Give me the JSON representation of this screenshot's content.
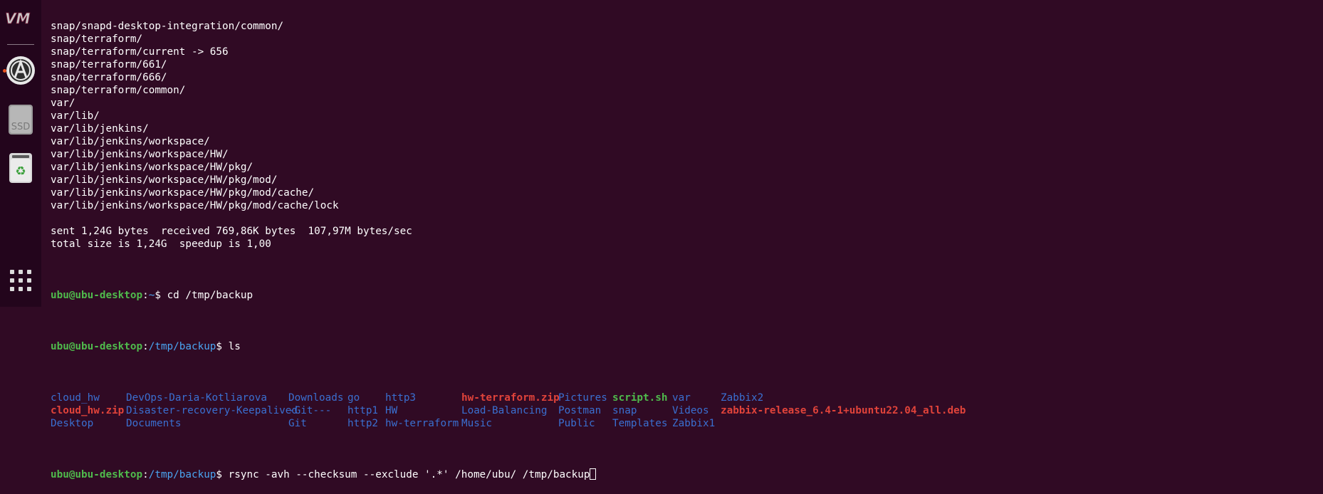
{
  "dock": {
    "items": [
      {
        "name": "virt-manager-icon"
      },
      {
        "name": "apt-package-icon"
      },
      {
        "name": "ssd-drive-icon",
        "label": "SSD"
      },
      {
        "name": "trash-icon"
      },
      {
        "name": "show-apps-grid-icon"
      }
    ]
  },
  "terminal": {
    "output_lines": [
      "snap/snapd-desktop-integration/common/",
      "snap/terraform/",
      "snap/terraform/current -> 656",
      "snap/terraform/661/",
      "snap/terraform/666/",
      "snap/terraform/common/",
      "var/",
      "var/lib/",
      "var/lib/jenkins/",
      "var/lib/jenkins/workspace/",
      "var/lib/jenkins/workspace/HW/",
      "var/lib/jenkins/workspace/HW/pkg/",
      "var/lib/jenkins/workspace/HW/pkg/mod/",
      "var/lib/jenkins/workspace/HW/pkg/mod/cache/",
      "var/lib/jenkins/workspace/HW/pkg/mod/cache/lock",
      "",
      "sent 1,24G bytes  received 769,86K bytes  107,97M bytes/sec",
      "total size is 1,24G  speedup is 1,00"
    ],
    "prompts": [
      {
        "user": "ubu@ubu-desktop",
        "sep": ":",
        "path": "~",
        "symbol": "$ ",
        "command": "cd /tmp/backup"
      },
      {
        "user": "ubu@ubu-desktop",
        "sep": ":",
        "path": "/tmp/backup",
        "symbol": "$ ",
        "command": "ls"
      },
      {
        "user": "ubu@ubu-desktop",
        "sep": ":",
        "path": "/tmp/backup",
        "symbol": "$ ",
        "command": "rsync -avh --checksum --exclude '.*' /home/ubu/ /tmp/backup"
      }
    ],
    "ls_columns": [
      [
        {
          "t": "cloud_hw",
          "k": "dir"
        },
        {
          "t": "cloud_hw.zip",
          "k": "red"
        },
        {
          "t": "Desktop",
          "k": "dir"
        }
      ],
      [
        {
          "t": "DevOps-Daria-Kotliarova",
          "k": "dir"
        },
        {
          "t": "Disaster-recovery-Keepalived",
          "k": "dir"
        },
        {
          "t": "Documents",
          "k": "dir"
        }
      ],
      [
        {
          "t": "Downloads",
          "k": "dir"
        },
        {
          "t": "-Git---",
          "k": "dir"
        },
        {
          "t": "Git",
          "k": "dir"
        }
      ],
      [
        {
          "t": "go",
          "k": "dir"
        },
        {
          "t": "http1",
          "k": "dir"
        },
        {
          "t": "http2",
          "k": "dir"
        }
      ],
      [
        {
          "t": "http3",
          "k": "dir"
        },
        {
          "t": "HW",
          "k": "dir"
        },
        {
          "t": "hw-terraform",
          "k": "dir"
        }
      ],
      [
        {
          "t": "hw-terraform.zip",
          "k": "red"
        },
        {
          "t": "Load-Balancing",
          "k": "dir"
        },
        {
          "t": "Music",
          "k": "dir"
        }
      ],
      [
        {
          "t": "Pictures",
          "k": "dir"
        },
        {
          "t": "Postman",
          "k": "dir"
        },
        {
          "t": "Public",
          "k": "dir"
        }
      ],
      [
        {
          "t": "script.sh",
          "k": "green"
        },
        {
          "t": "snap",
          "k": "dir"
        },
        {
          "t": "Templates",
          "k": "dir"
        }
      ],
      [
        {
          "t": "var",
          "k": "dir"
        },
        {
          "t": "Videos",
          "k": "dir"
        },
        {
          "t": "Zabbix1",
          "k": "dir"
        }
      ],
      [
        {
          "t": "Zabbix2",
          "k": "dir"
        },
        {
          "t": "zabbix-release_6.4-1+ubuntu22.04_all.deb",
          "k": "red"
        },
        {
          "t": "",
          "k": "dir"
        }
      ]
    ],
    "colors": {
      "background": "#300a24",
      "prompt_user": "#4fbb4c",
      "prompt_path": "#4aa4f0",
      "directory": "#3a6fd0",
      "archive": "#e0433a",
      "executable": "#4fbb4c"
    }
  }
}
